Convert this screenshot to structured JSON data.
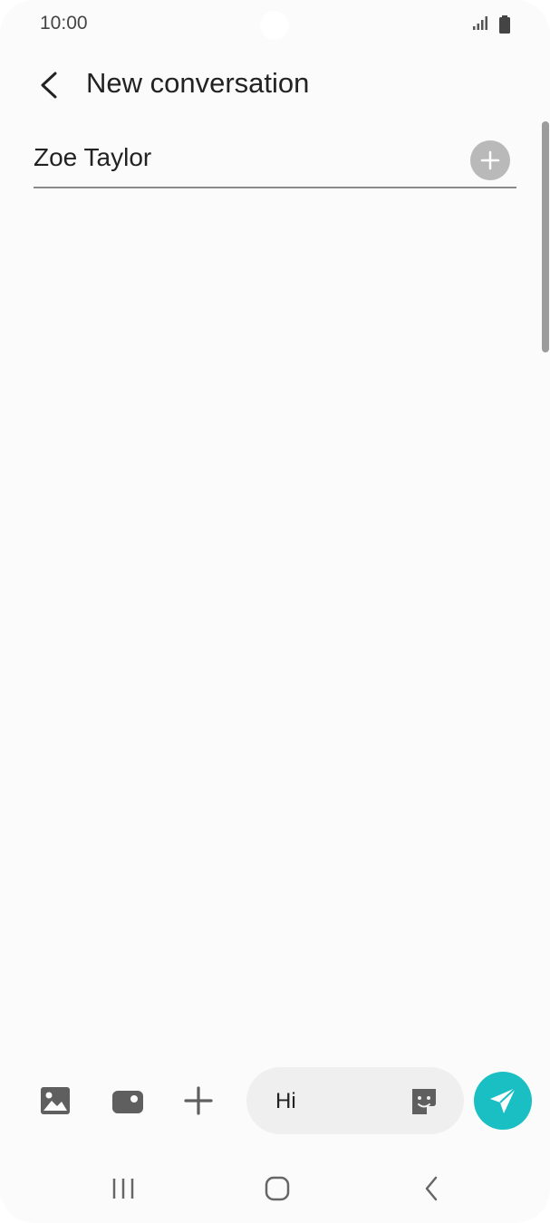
{
  "status_bar": {
    "time": "10:00"
  },
  "header": {
    "title": "New conversation"
  },
  "recipient": {
    "name": "Zoe Taylor"
  },
  "composer": {
    "message_text": "Hi"
  },
  "colors": {
    "accent": "#1abfc4",
    "background": "#fbfbfb"
  },
  "icons": {
    "back": "arrow-left-icon",
    "add": "plus-circle-icon",
    "gallery": "image-icon",
    "camera": "camera-icon",
    "more": "plus-icon",
    "sticker": "sticker-icon",
    "send": "send-icon",
    "nav_recents": "recents-icon",
    "nav_home": "home-icon",
    "nav_back": "nav-back-icon"
  }
}
